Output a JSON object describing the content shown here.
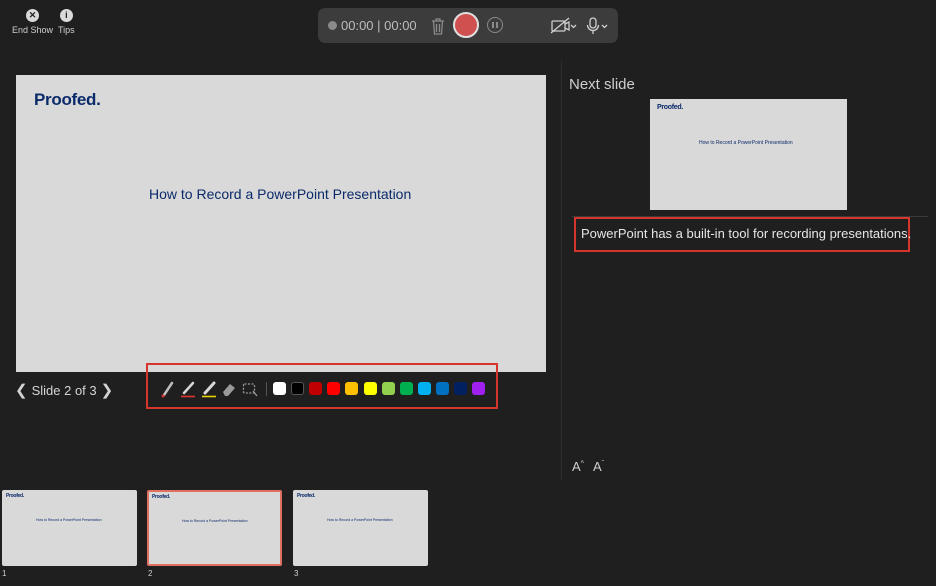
{
  "top_controls": {
    "end_show_label": "End Show",
    "tips_label": "Tips"
  },
  "recording": {
    "timer": "00:00 | 00:00",
    "colors": {
      "record": "#d05050"
    }
  },
  "slide": {
    "brand": "Proofed.",
    "title": "How to Record a PowerPoint Presentation"
  },
  "navigation": {
    "slide_counter": "Slide 2 of 3"
  },
  "annotation_tools": {
    "tools": [
      "laser-pointer",
      "pen",
      "highlighter",
      "eraser",
      "lasso-select"
    ],
    "colors": [
      "#ffffff",
      "#000000",
      "#c00000",
      "#ff0000",
      "#ffc000",
      "#ffff00",
      "#92d050",
      "#00b050",
      "#00b0f0",
      "#0070c0",
      "#002060",
      "#a020f0"
    ]
  },
  "next_slide": {
    "label": "Next slide",
    "brand": "Proofed.",
    "title": "How to Record a PowerPoint Presentation"
  },
  "notes": {
    "text": "PowerPoint has a built-in tool for recording presentations."
  },
  "font_controls": {
    "increase": "A",
    "decrease": "A"
  },
  "filmstrip": {
    "selected_index": 1,
    "slides": [
      {
        "number": "1",
        "brand": "Proofed.",
        "title": "How to Record a PowerPoint Presentation"
      },
      {
        "number": "2",
        "brand": "Proofed.",
        "title": "How to Record a PowerPoint Presentation"
      },
      {
        "number": "3",
        "brand": "Proofed.",
        "title": "How to Record a PowerPoint Presentation"
      }
    ]
  }
}
